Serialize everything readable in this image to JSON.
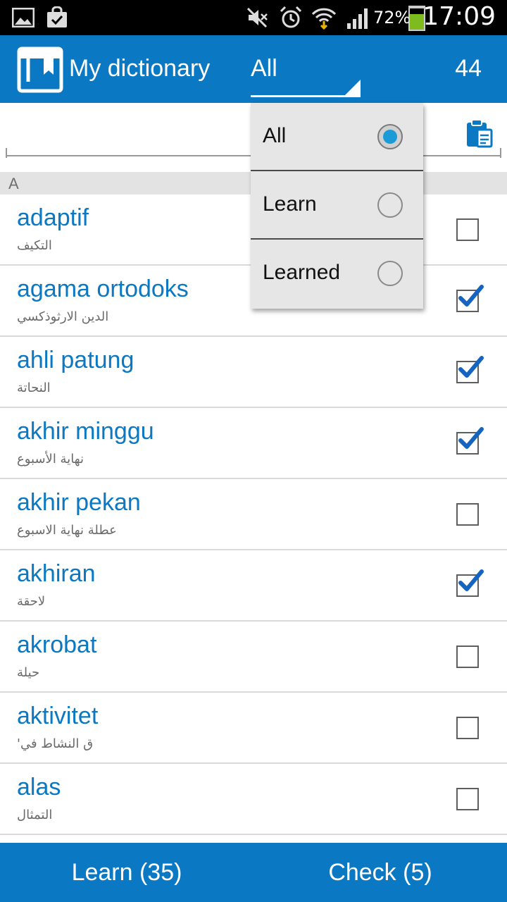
{
  "status_bar": {
    "battery_percent": "72%",
    "time": "17:09",
    "icons": [
      "gallery-icon",
      "bag-check-icon",
      "mute-icon",
      "alarm-icon",
      "wifi-icon",
      "signal-icon",
      "battery-icon"
    ]
  },
  "app_bar": {
    "title": "My dictionary",
    "filter_value": "All",
    "count": "44",
    "icon": "dictionary-book-icon"
  },
  "search": {
    "value": "",
    "placeholder": "",
    "paste_icon": "clipboard-paste-icon"
  },
  "section_header": "A",
  "words": [
    {
      "word": "adaptif",
      "translation": "التكيف",
      "checked": false
    },
    {
      "word": "agama ortodoks",
      "translation": "الدين الارثوذكسي",
      "checked": true
    },
    {
      "word": "ahli patung",
      "translation": "النحاتة",
      "checked": true
    },
    {
      "word": "akhir minggu",
      "translation": "نهاية الأسبوع",
      "checked": true
    },
    {
      "word": "akhir pekan",
      "translation": "عطلة نهاية الاسبوع",
      "checked": false
    },
    {
      "word": "akhiran",
      "translation": "لاحقة",
      "checked": true
    },
    {
      "word": "akrobat",
      "translation": "حيلة",
      "checked": false
    },
    {
      "word": "aktivitet",
      "translation": "ق النشاط في'",
      "checked": false
    },
    {
      "word": "alas",
      "translation": "التمثال",
      "checked": false
    }
  ],
  "dropdown": {
    "options": [
      {
        "label": "All",
        "selected": true
      },
      {
        "label": "Learn",
        "selected": false
      },
      {
        "label": "Learned",
        "selected": false
      }
    ]
  },
  "bottom_bar": {
    "learn_label": "Learn (35)",
    "check_label": "Check (5)"
  },
  "colors": {
    "primary": "#0a78c2",
    "radio_accent": "#1a9ad6",
    "checkmark": "#1565c0"
  }
}
